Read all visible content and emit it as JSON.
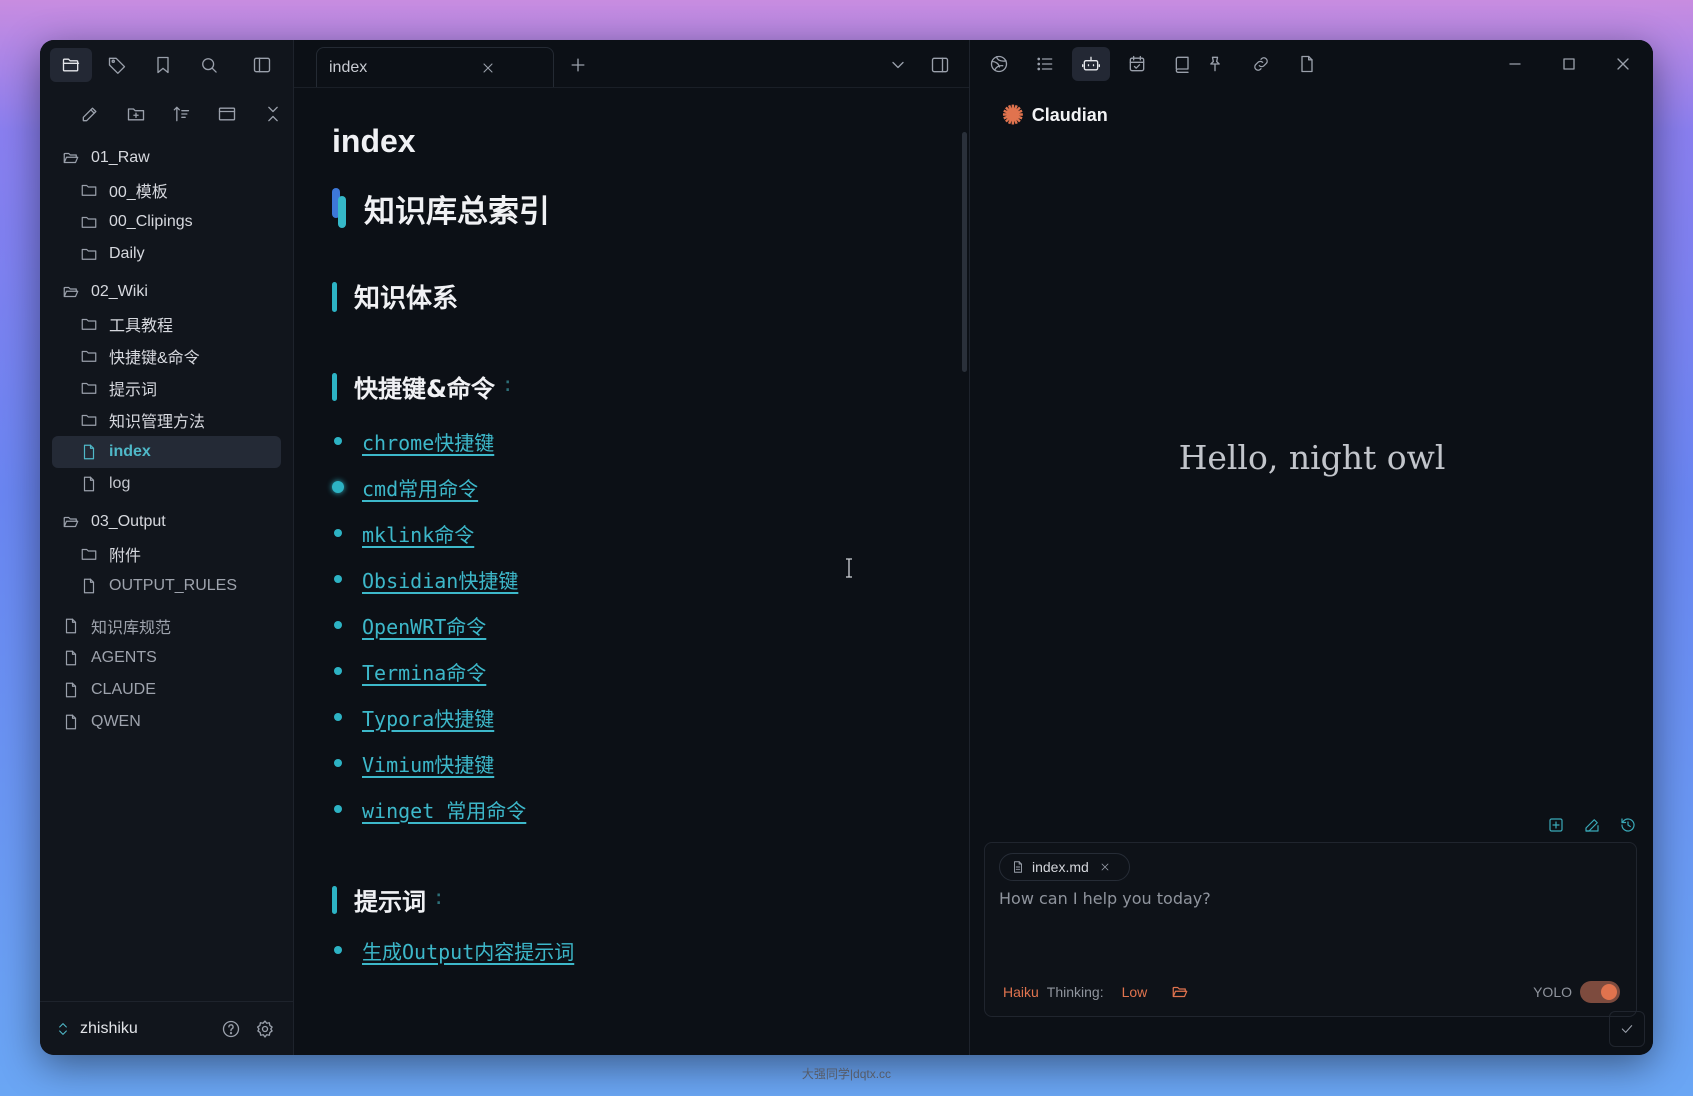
{
  "sidebar": {
    "top_icons": [
      "folder-icon",
      "tag-icon",
      "bookmark-icon",
      "search-icon",
      "sidebar-toggle-icon"
    ],
    "action_icons": [
      "new-note-icon",
      "new-folder-icon",
      "sort-icon",
      "collapse-view-icon",
      "collapse-all-icon"
    ],
    "tree": [
      {
        "label": "01_Raw",
        "type": "folder",
        "children": [
          {
            "label": "00_模板"
          },
          {
            "label": "00_Clipings"
          },
          {
            "label": "Daily"
          }
        ]
      },
      {
        "label": "02_Wiki",
        "type": "folder",
        "children": [
          {
            "label": "工具教程"
          },
          {
            "label": "快捷键&命令"
          },
          {
            "label": "提示词"
          },
          {
            "label": "知识管理方法"
          },
          {
            "label": "index",
            "active": true
          },
          {
            "label": "log"
          }
        ]
      },
      {
        "label": "03_Output",
        "type": "folder",
        "children": [
          {
            "label": "附件"
          },
          {
            "label": "OUTPUT_RULES"
          }
        ]
      },
      {
        "label": "知识库规范"
      },
      {
        "label": "AGENTS"
      },
      {
        "label": "CLAUDE"
      },
      {
        "label": "QWEN"
      }
    ],
    "vault_name": "zhishiku"
  },
  "editor": {
    "tab_label": "index",
    "inline_title": "index",
    "h1": "知识库总索引",
    "h2": "知识体系",
    "section1": {
      "title": "快捷键&命令",
      "links": [
        "chrome快捷键",
        "cmd常用命令",
        "mklink命令",
        "Obsidian快捷键",
        "OpenWRT命令",
        "Termina命令",
        "Typora快捷键",
        "Vimium快捷键",
        "winget 常用命令"
      ]
    },
    "section2": {
      "title": "提示词",
      "links": [
        "生成Output内容提示词"
      ]
    }
  },
  "right_panel": {
    "brand": "Claudian",
    "greeting": "Hello, night owl",
    "attachment": "index.md",
    "prompt_placeholder": "How can I help you today?",
    "model": "Haiku",
    "thinking_label": "Thinking:",
    "thinking_level": "Low",
    "yolo_label": "YOLO",
    "yolo_enabled": true
  },
  "watermark": "大强同学|dqtx.cc",
  "colors": {
    "accent": "#2db3c4",
    "claude_orange": "#e0734e",
    "bg": "#0c1016"
  }
}
